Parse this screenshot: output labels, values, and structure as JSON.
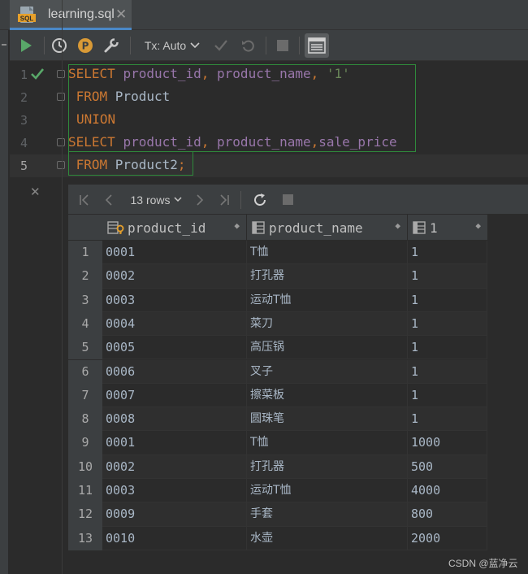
{
  "tab": {
    "title": "learning.sql",
    "close_glyph": "✕",
    "icon": "sql-file-icon"
  },
  "toolbar": {
    "tx_label": "Tx: Auto",
    "icons": [
      "run-icon",
      "history-icon",
      "p-icon",
      "wrench-icon",
      "check-icon",
      "rollback-icon",
      "stop-icon",
      "console-icon"
    ]
  },
  "editor": {
    "lines": [
      {
        "num": "1",
        "tokens": [
          {
            "t": "SELECT ",
            "c": "kw"
          },
          {
            "t": "product_id",
            "c": "col"
          },
          {
            "t": ", ",
            "c": "kw"
          },
          {
            "t": "product_name",
            "c": "col"
          },
          {
            "t": ", ",
            "c": "kw"
          },
          {
            "t": "'1'",
            "c": "str"
          }
        ]
      },
      {
        "num": "2",
        "tokens": [
          {
            "t": " FROM ",
            "c": "kw"
          },
          {
            "t": "Product",
            "c": "plain"
          }
        ]
      },
      {
        "num": "3",
        "tokens": [
          {
            "t": "UNION",
            "c": "kw"
          }
        ]
      },
      {
        "num": "4",
        "tokens": [
          {
            "t": "SELECT ",
            "c": "kw"
          },
          {
            "t": "product_id",
            "c": "col"
          },
          {
            "t": ", ",
            "c": "kw"
          },
          {
            "t": "product_name",
            "c": "col"
          },
          {
            "t": ",",
            "c": "kw"
          },
          {
            "t": "sale_price",
            "c": "col"
          }
        ]
      },
      {
        "num": "5",
        "tokens": [
          {
            "t": " FROM ",
            "c": "kw"
          },
          {
            "t": "Product2",
            "c": "plain"
          },
          {
            "t": ";",
            "c": "kw"
          }
        ]
      }
    ]
  },
  "results": {
    "rows_label": "13 rows",
    "close_glyph": "✕",
    "columns": [
      {
        "label": "product_id",
        "icon": "key-column-icon"
      },
      {
        "label": "product_name",
        "icon": "column-icon"
      },
      {
        "label": "1",
        "icon": "column-icon"
      }
    ],
    "rows": [
      [
        "1",
        "0001",
        "T恤",
        "1"
      ],
      [
        "2",
        "0002",
        "打孔器",
        "1"
      ],
      [
        "3",
        "0003",
        "运动T恤",
        "1"
      ],
      [
        "4",
        "0004",
        "菜刀",
        "1"
      ],
      [
        "5",
        "0005",
        "高压锅",
        "1"
      ],
      [
        "6",
        "0006",
        "叉子",
        "1"
      ],
      [
        "7",
        "0007",
        "擦菜板",
        "1"
      ],
      [
        "8",
        "0008",
        "圆珠笔",
        "1"
      ],
      [
        "9",
        "0001",
        "T恤",
        "1000"
      ],
      [
        "10",
        "0002",
        "打孔器",
        "500"
      ],
      [
        "11",
        "0003",
        "运动T恤",
        "4000"
      ],
      [
        "12",
        "0009",
        "手套",
        "800"
      ],
      [
        "13",
        "0010",
        "水壶",
        "2000"
      ]
    ]
  },
  "watermark": "CSDN @蓝净云",
  "colors": {
    "keyword": "#cc7832",
    "column": "#9876aa",
    "string": "#6a8759",
    "background": "#2b2b2b",
    "accent": "#4a88c7"
  }
}
